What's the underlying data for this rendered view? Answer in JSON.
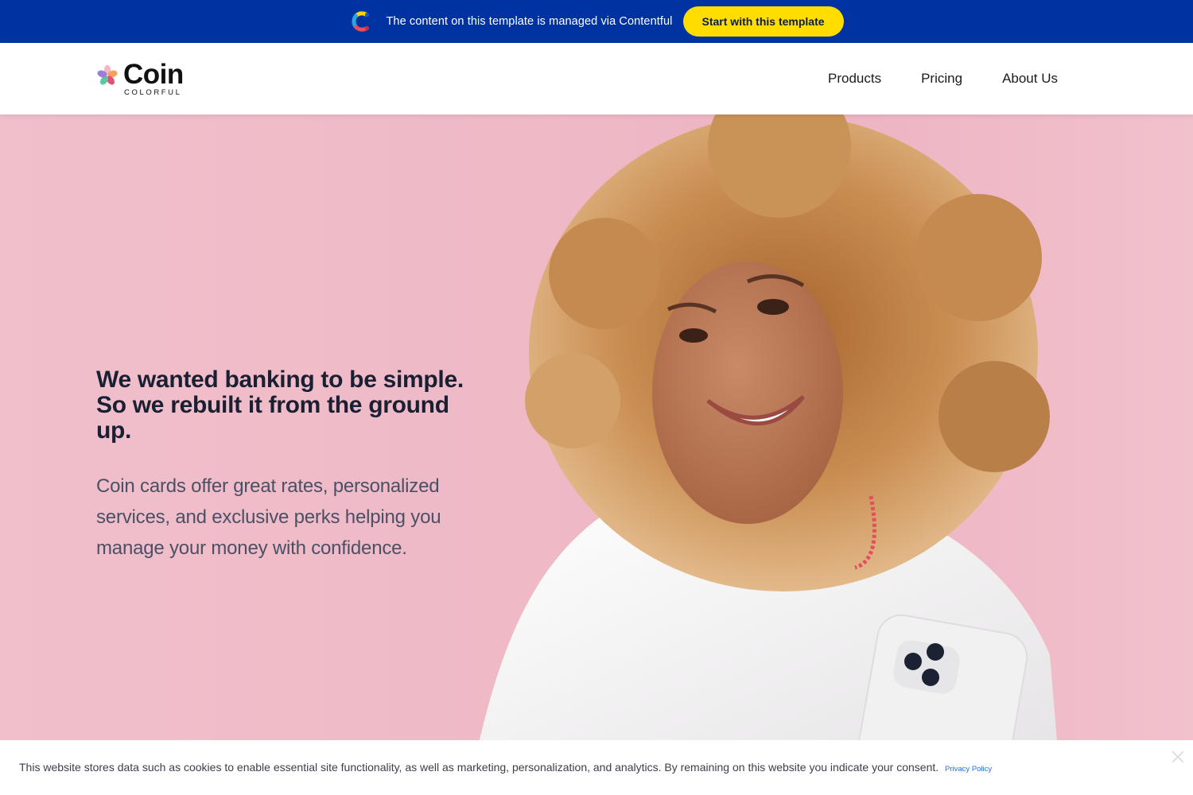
{
  "topbar": {
    "message": "The content on this template is managed via Contentful",
    "cta_label": "Start with this template",
    "logo_icon": "contentful-logo-icon",
    "background": "#0033a1",
    "cta_color": "#ffdd00"
  },
  "header": {
    "brand_name": "Coin",
    "brand_sub": "COLORFUL",
    "brand_icon": "flower-logo-icon",
    "nav": [
      {
        "label": "Products"
      },
      {
        "label": "Pricing"
      },
      {
        "label": "About Us"
      }
    ]
  },
  "hero": {
    "headline": "We wanted banking to be simple. So we rebuilt it from the ground up.",
    "body": "Coin cards offer great rates, personalized services, and exclusive perks helping you manage your money with confidence.",
    "image": "woman-with-curly-hair-holding-phone-photo",
    "background": "#efb9c6"
  },
  "cookie_banner": {
    "text": "This website stores data such as cookies to enable essential site functionality, as well as marketing, personalization, and analytics. By remaining on this website you indicate your consent.",
    "link_label": "Privacy Policy",
    "close_icon": "close-icon"
  }
}
